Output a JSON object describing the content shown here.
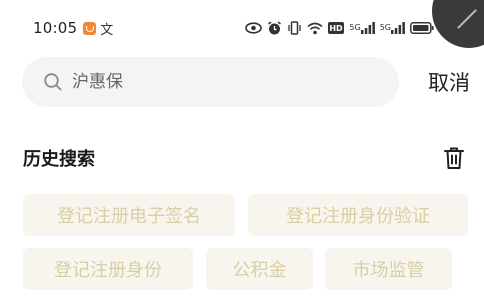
{
  "status_bar": {
    "time": "10:05",
    "app_glyph": "文",
    "network_labels": [
      "5G",
      "5G"
    ],
    "hd_label": "HD"
  },
  "search": {
    "placeholder": "沪惠保",
    "cancel_label": "取消"
  },
  "history": {
    "title": "历史搜索",
    "items": [
      "登记注册电子签名",
      "登记注册身份验证",
      "登记注册身份",
      "公积金",
      "市场监管"
    ]
  },
  "icons": {
    "search": "search-icon",
    "delete": "trash-icon"
  },
  "colors": {
    "chip_bg": "#f7f5ee",
    "chip_text": "#d9cfa6",
    "search_bg": "#f4f4f4",
    "badge": "#f0883a"
  }
}
